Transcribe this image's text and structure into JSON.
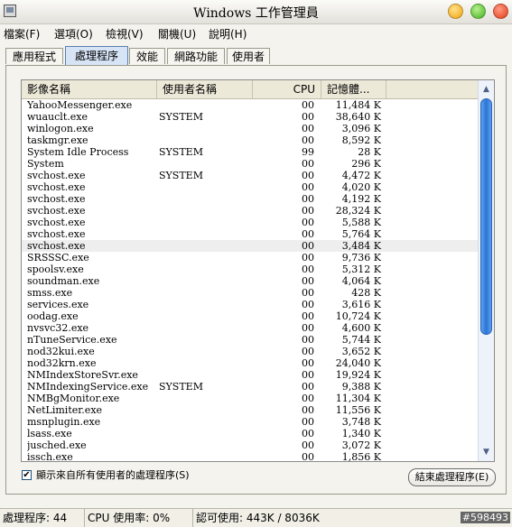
{
  "window": {
    "title": "Windows 工作管理員"
  },
  "menu": [
    "檔案(F)",
    "選項(O)",
    "檢視(V)",
    "關機(U)",
    "說明(H)"
  ],
  "tabs": [
    "應用程式",
    "處理程序",
    "效能",
    "網路功能",
    "使用者"
  ],
  "active_tab": 1,
  "table": {
    "columns": [
      "影像名稱",
      "使用者名稱",
      "CPU",
      "記憶體..."
    ],
    "rows": [
      [
        "YahooMessenger.exe",
        "",
        "00",
        "11,484 K"
      ],
      [
        "wuauclt.exe",
        "SYSTEM",
        "00",
        "38,640 K"
      ],
      [
        "winlogon.exe",
        "",
        "00",
        "3,096 K"
      ],
      [
        "taskmgr.exe",
        "",
        "00",
        "8,592 K"
      ],
      [
        "System Idle Process",
        "SYSTEM",
        "99",
        "28 K"
      ],
      [
        "System",
        "",
        "00",
        "296 K"
      ],
      [
        "svchost.exe",
        "SYSTEM",
        "00",
        "4,472 K"
      ],
      [
        "svchost.exe",
        "",
        "00",
        "4,020 K"
      ],
      [
        "svchost.exe",
        "",
        "00",
        "4,192 K"
      ],
      [
        "svchost.exe",
        "",
        "00",
        "28,324 K"
      ],
      [
        "svchost.exe",
        "",
        "00",
        "5,588 K"
      ],
      [
        "svchost.exe",
        "",
        "00",
        "5,764 K"
      ],
      [
        "svchost.exe",
        "",
        "00",
        "3,484 K"
      ],
      [
        "SRSSSC.exe",
        "",
        "00",
        "9,736 K"
      ],
      [
        "spoolsv.exe",
        "",
        "00",
        "5,312 K"
      ],
      [
        "soundman.exe",
        "",
        "00",
        "4,064 K"
      ],
      [
        "smss.exe",
        "",
        "00",
        "428 K"
      ],
      [
        "services.exe",
        "",
        "00",
        "3,616 K"
      ],
      [
        "oodag.exe",
        "",
        "00",
        "10,724 K"
      ],
      [
        "nvsvc32.exe",
        "",
        "00",
        "4,600 K"
      ],
      [
        "nTuneService.exe",
        "",
        "00",
        "5,744 K"
      ],
      [
        "nod32kui.exe",
        "",
        "00",
        "3,652 K"
      ],
      [
        "nod32krn.exe",
        "",
        "00",
        "24,040 K"
      ],
      [
        "NMIndexStoreSvr.exe",
        "",
        "00",
        "19,924 K"
      ],
      [
        "NMIndexingService.exe",
        "SYSTEM",
        "00",
        "9,388 K"
      ],
      [
        "NMBgMonitor.exe",
        "",
        "00",
        "11,304 K"
      ],
      [
        "NetLimiter.exe",
        "",
        "00",
        "11,556 K"
      ],
      [
        "msnplugin.exe",
        "",
        "00",
        "3,748 K"
      ],
      [
        "lsass.exe",
        "",
        "00",
        "1,340 K"
      ],
      [
        "jusched.exe",
        "",
        "00",
        "3,072 K"
      ],
      [
        "issch.exe",
        "",
        "00",
        "1,856 K"
      ]
    ],
    "selected_row": 12
  },
  "show_all_label": "顯示來自所有使用者的處理程序(S)",
  "show_all_checked": true,
  "end_process_label": "結束處理程序(E)",
  "status": {
    "processes": "處理程序: 44",
    "cpu": "CPU 使用率: 0%",
    "commit": "認可使用: 443K / 8036K"
  },
  "watermark": "#598493"
}
